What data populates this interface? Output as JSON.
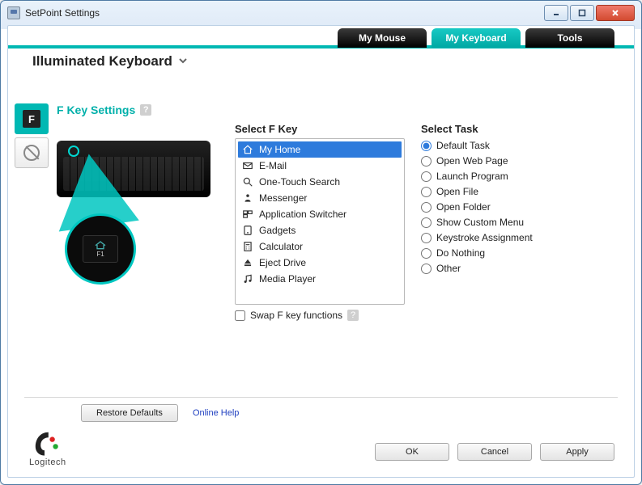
{
  "window": {
    "title": "SetPoint Settings"
  },
  "tabs": {
    "mouse": "My Mouse",
    "keyboard": "My Keyboard",
    "tools": "Tools",
    "active": "keyboard"
  },
  "device": {
    "name": "Illuminated Keyboard"
  },
  "section": {
    "title": "F Key Settings"
  },
  "fkeys": {
    "heading": "Select F Key",
    "items": [
      {
        "label": "My Home",
        "icon": "home-icon"
      },
      {
        "label": "E-Mail",
        "icon": "mail-icon"
      },
      {
        "label": "One-Touch Search",
        "icon": "search-icon"
      },
      {
        "label": "Messenger",
        "icon": "messenger-icon"
      },
      {
        "label": "Application Switcher",
        "icon": "appswitch-icon"
      },
      {
        "label": "Gadgets",
        "icon": "gadgets-icon"
      },
      {
        "label": "Calculator",
        "icon": "calculator-icon"
      },
      {
        "label": "Eject Drive",
        "icon": "eject-icon"
      },
      {
        "label": "Media Player",
        "icon": "music-icon"
      }
    ],
    "selected_index": 0,
    "swap_label": "Swap F key functions",
    "zoom_key": "F1"
  },
  "tasks": {
    "heading": "Select Task",
    "options": [
      "Default Task",
      "Open Web Page",
      "Launch Program",
      "Open File",
      "Open Folder",
      "Show Custom Menu",
      "Keystroke Assignment",
      "Do Nothing",
      "Other"
    ],
    "selected_index": 0
  },
  "footer": {
    "restore": "Restore Defaults",
    "help": "Online Help",
    "ok": "OK",
    "cancel": "Cancel",
    "apply": "Apply",
    "brand": "Logitech"
  }
}
